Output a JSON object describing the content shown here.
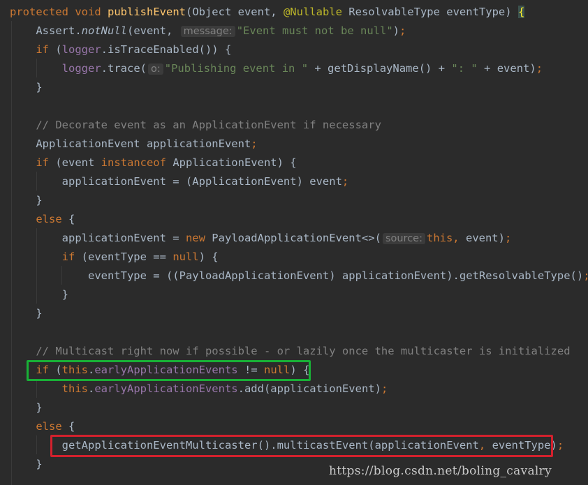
{
  "editor": {
    "language": "Java",
    "theme_colors": {
      "background": "#2b2b2b",
      "keyword": "#cc7832",
      "method_declaration": "#ffc66d",
      "annotation": "#bbb529",
      "string": "#6a8759",
      "comment": "#808080",
      "field": "#9876aa",
      "plain": "#a9b7c6",
      "highlight_green": "#18b036",
      "highlight_red": "#d3212d"
    },
    "lines": [
      [
        {
          "c": "kw",
          "t": "protected "
        },
        {
          "c": "kw",
          "t": "void "
        },
        {
          "c": "fn",
          "t": "publishEvent"
        },
        {
          "t": "(Object event, "
        },
        {
          "c": "ann",
          "t": "@Nullable "
        },
        {
          "t": "ResolvableType eventType) "
        },
        {
          "c": "brace-hl",
          "t": "{"
        }
      ],
      [
        {
          "t": "    Assert."
        },
        {
          "c": "it",
          "t": "notNull"
        },
        {
          "t": "(event, "
        },
        {
          "c": "hint",
          "t": "message:"
        },
        {
          "c": "str",
          "t": "\"Event must not be null\""
        },
        {
          "t": ")"
        },
        {
          "c": "kw",
          "t": ";"
        }
      ],
      [
        {
          "c": "kw",
          "t": "    if "
        },
        {
          "t": "("
        },
        {
          "c": "fld",
          "t": "logger"
        },
        {
          "t": ".isTraceEnabled()) {"
        }
      ],
      [
        {
          "t": "        "
        },
        {
          "c": "fld",
          "t": "logger"
        },
        {
          "t": ".trace("
        },
        {
          "c": "hint",
          "t": "o:"
        },
        {
          "c": "str",
          "t": "\"Publishing event in \""
        },
        {
          "t": " + getDisplayName() + "
        },
        {
          "c": "str",
          "t": "\": \""
        },
        {
          "t": " + event)"
        },
        {
          "c": "kw",
          "t": ";"
        }
      ],
      [
        {
          "t": "    }"
        }
      ],
      [
        {
          "t": ""
        }
      ],
      [
        {
          "c": "cm",
          "t": "    // Decorate event as an ApplicationEvent if necessary"
        }
      ],
      [
        {
          "t": "    ApplicationEvent applicationEvent"
        },
        {
          "c": "kw",
          "t": ";"
        }
      ],
      [
        {
          "c": "kw",
          "t": "    if "
        },
        {
          "t": "(event "
        },
        {
          "c": "kw",
          "t": "instanceof "
        },
        {
          "t": "ApplicationEvent) {"
        }
      ],
      [
        {
          "t": "        applicationEvent = (ApplicationEvent) event"
        },
        {
          "c": "kw",
          "t": ";"
        }
      ],
      [
        {
          "t": "    }"
        }
      ],
      [
        {
          "c": "kw",
          "t": "    else "
        },
        {
          "t": "{"
        }
      ],
      [
        {
          "t": "        applicationEvent = "
        },
        {
          "c": "kw",
          "t": "new "
        },
        {
          "t": "PayloadApplicationEvent<>("
        },
        {
          "c": "hint",
          "t": "source:"
        },
        {
          "c": "kw",
          "t": "this, "
        },
        {
          "t": "event)"
        },
        {
          "c": "kw",
          "t": ";"
        }
      ],
      [
        {
          "c": "kw",
          "t": "        if "
        },
        {
          "t": "(eventType == "
        },
        {
          "c": "kw",
          "t": "null"
        },
        {
          "t": ") {"
        }
      ],
      [
        {
          "t": "            eventType = ((PayloadApplicationEvent) applicationEvent).getResolvableType()"
        },
        {
          "c": "kw",
          "t": ";"
        }
      ],
      [
        {
          "t": "        }"
        }
      ],
      [
        {
          "t": "    }"
        }
      ],
      [
        {
          "t": ""
        }
      ],
      [
        {
          "c": "cm",
          "t": "    // Multicast right now if possible - or lazily once the multicaster is initialized"
        }
      ],
      [
        {
          "c": "kw",
          "t": "    if "
        },
        {
          "t": "("
        },
        {
          "c": "kw",
          "t": "this"
        },
        {
          "t": "."
        },
        {
          "c": "fld",
          "t": "earlyApplicationEvents "
        },
        {
          "t": "!= "
        },
        {
          "c": "kw",
          "t": "null"
        },
        {
          "t": ") {"
        }
      ],
      [
        {
          "c": "kw",
          "t": "        this"
        },
        {
          "t": "."
        },
        {
          "c": "fld",
          "t": "earlyApplicationEvents"
        },
        {
          "t": ".add(applicationEvent)"
        },
        {
          "c": "kw",
          "t": ";"
        }
      ],
      [
        {
          "t": "    }"
        }
      ],
      [
        {
          "c": "kw",
          "t": "    else "
        },
        {
          "t": "{"
        }
      ],
      [
        {
          "t": "        getApplicationEventMulticaster().multicastEvent(applicationEvent"
        },
        {
          "c": "kw",
          "t": ", "
        },
        {
          "t": "eventType)"
        },
        {
          "c": "kw",
          "t": ";"
        }
      ],
      [
        {
          "t": "    }"
        }
      ]
    ]
  },
  "watermark": "https://blog.csdn.net/boling_cavalry"
}
